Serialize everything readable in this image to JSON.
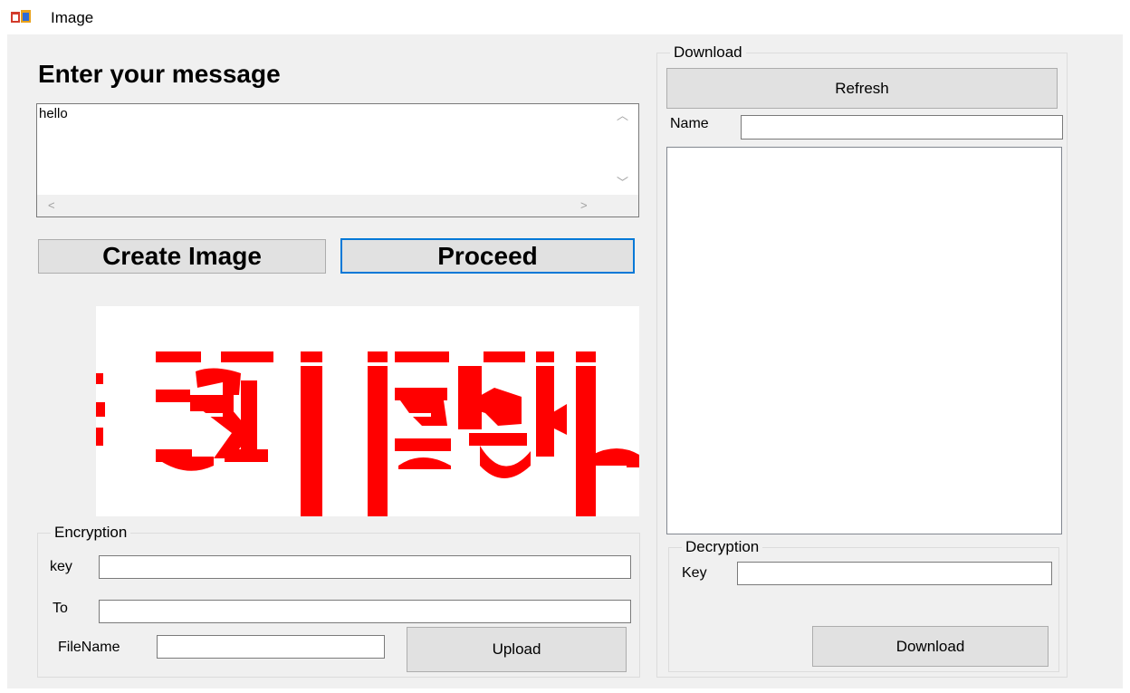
{
  "window": {
    "title": "Image",
    "icon": "windows-form-icon"
  },
  "compose": {
    "heading": "Enter your message",
    "message_text": "hello",
    "create_image_label": "Create Image",
    "proceed_label": "Proceed"
  },
  "encryption": {
    "group_label": "Encryption",
    "key_label": "key",
    "key_value": "",
    "to_label": "To",
    "to_value": "",
    "filename_label": "FileName",
    "filename_value": "",
    "upload_label": "Upload"
  },
  "download": {
    "group_label": "Download",
    "refresh_label": "Refresh",
    "name_label": "Name",
    "name_value": "",
    "list_items": []
  },
  "decryption": {
    "group_label": "Decryption",
    "key_label": "Key",
    "key_value": "",
    "download_label": "Download"
  },
  "colors": {
    "window_bg": "#f0f0f0",
    "button_bg": "#e1e1e1",
    "focus_border": "#0078d7",
    "captcha_red": "#ff0000"
  }
}
